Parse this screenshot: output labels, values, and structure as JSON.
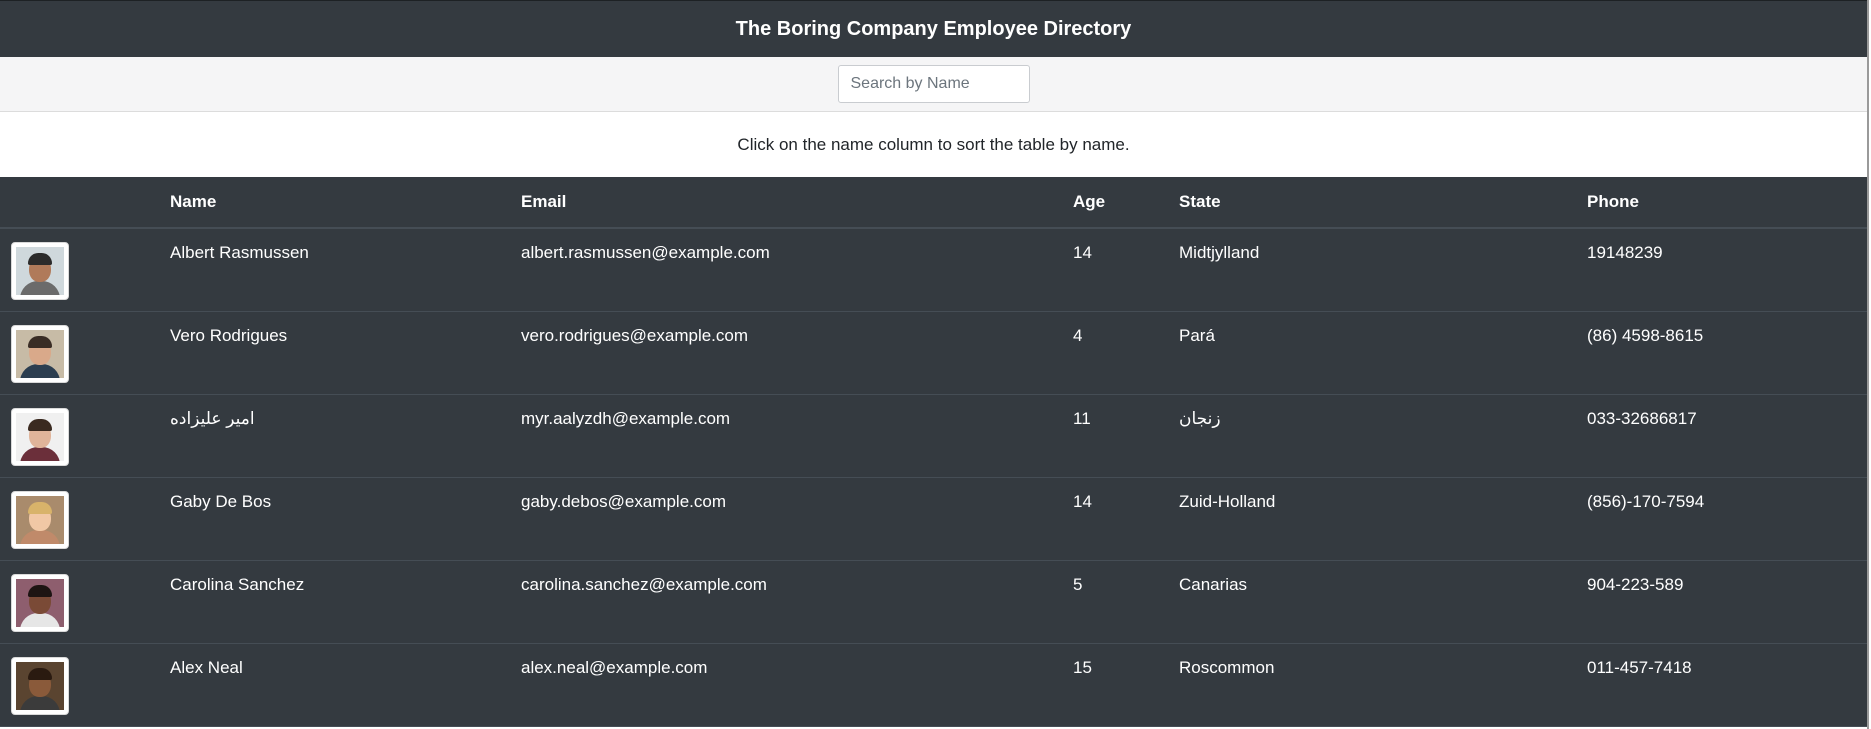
{
  "header": {
    "title": "The Boring Company Employee Directory"
  },
  "search": {
    "placeholder": "Search by Name"
  },
  "instructions": "Click on the name column to sort the table by name.",
  "table": {
    "columns": [
      "",
      "Name",
      "Email",
      "Age",
      "State",
      "Phone"
    ],
    "rows": [
      {
        "name": "Albert Rasmussen",
        "email": "albert.rasmussen@example.com",
        "age": "14",
        "state": "Midtjylland",
        "phone": "19148239",
        "avatar": "man-avatar-photo"
      },
      {
        "name": "Vero Rodrigues",
        "email": "vero.rodrigues@example.com",
        "age": "4",
        "state": "Pará",
        "phone": "(86) 4598-8615",
        "avatar": "man-avatar-photo"
      },
      {
        "name": "امیر علیزاده",
        "email": "myr.aalyzdh@example.com",
        "age": "11",
        "state": "زنجان",
        "phone": "033-32686817",
        "avatar": "man-avatar-photo"
      },
      {
        "name": "Gaby De Bos",
        "email": "gaby.debos@example.com",
        "age": "14",
        "state": "Zuid-Holland",
        "phone": "(856)-170-7594",
        "avatar": "woman-avatar-photo"
      },
      {
        "name": "Carolina Sanchez",
        "email": "carolina.sanchez@example.com",
        "age": "5",
        "state": "Canarias",
        "phone": "904-223-589",
        "avatar": "woman-avatar-photo"
      },
      {
        "name": "Alex Neal",
        "email": "alex.neal@example.com",
        "age": "15",
        "state": "Roscommon",
        "phone": "011-457-7418",
        "avatar": "man-avatar-photo"
      }
    ]
  },
  "colors": {
    "dark_bg": "#343a40",
    "row_border": "#454d55",
    "search_bg": "#f5f5f6",
    "text_light": "#ffffff"
  }
}
